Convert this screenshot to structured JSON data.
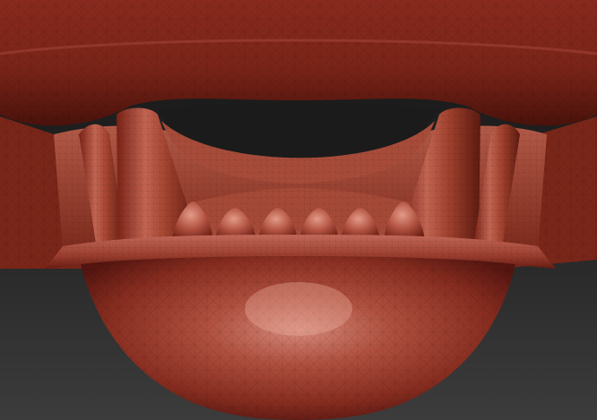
{
  "viewport": {
    "name": "3d-sculpt-viewport",
    "subject": "sculpted-creature-jaw-mesh"
  },
  "colors": {
    "background_top": "#161616",
    "background_bottom": "#3a3a3a",
    "clay_light": "#c46a5c",
    "clay_mid": "#9b3a2c",
    "clay_dark": "#5a170f",
    "clay_shadow": "#3a0d08",
    "highlight": "#e8a090"
  },
  "mesh": {
    "wireframe_visible": true,
    "teeth_count": 6,
    "tusks_count": 4
  }
}
